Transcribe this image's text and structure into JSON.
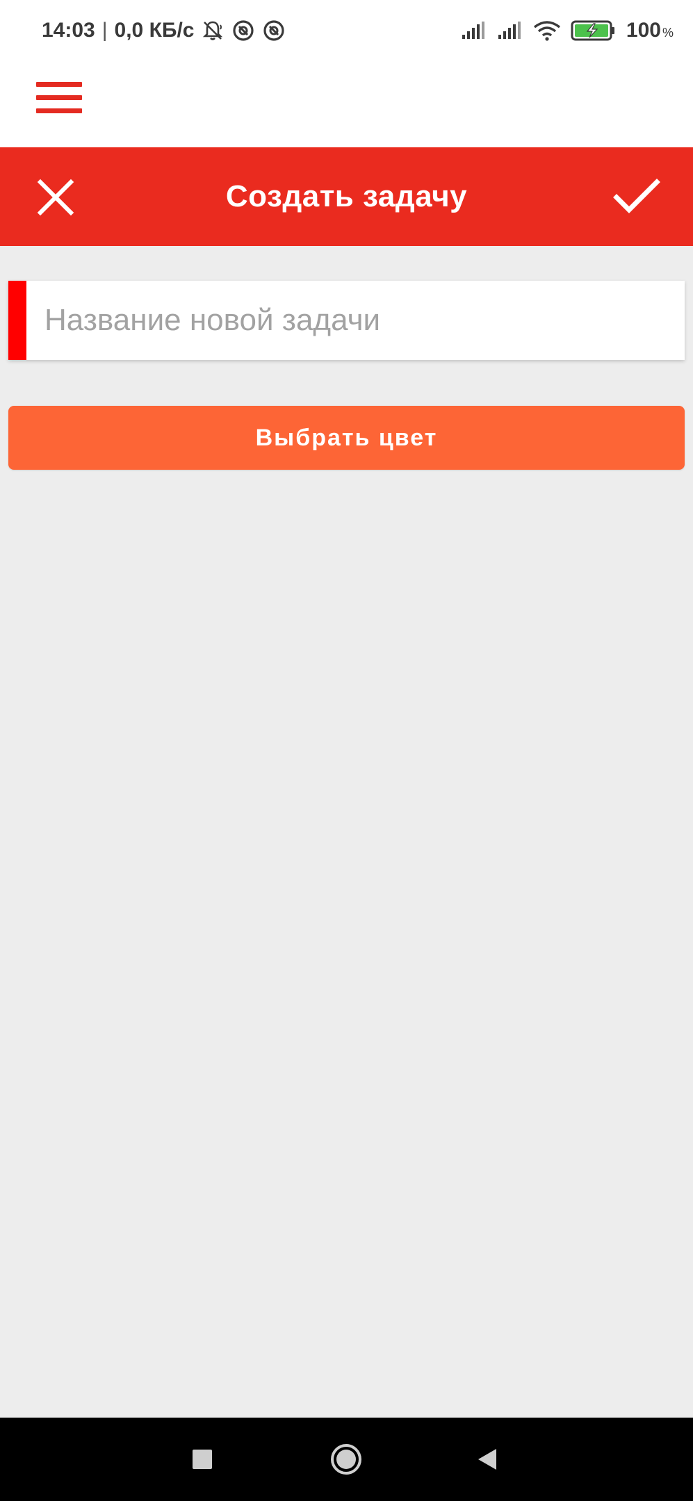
{
  "status_bar": {
    "time": "14:03",
    "separator": "|",
    "speed": "0,0 КБ/с",
    "battery_percent": "100",
    "percent_sign": "%",
    "icons": [
      "bell-off-icon",
      "at-sign-icon",
      "at-sign-icon",
      "signal-icon",
      "signal-icon",
      "wifi-icon",
      "battery-charging-icon"
    ]
  },
  "app_bar": {
    "menu_icon": "hamburger-menu-icon"
  },
  "header": {
    "title": "Создать задачу",
    "close_icon": "close-icon",
    "confirm_icon": "check-icon",
    "background_color": "#ea2b1f"
  },
  "form": {
    "task_name": {
      "value": "",
      "placeholder": "Название новой задачи",
      "strip_color": "#ff0000"
    },
    "choose_color_button": {
      "label": "Выбрать цвет",
      "color": "#fd6536"
    }
  },
  "nav_bar": {
    "buttons": [
      "recents-icon",
      "home-icon",
      "back-icon"
    ]
  }
}
